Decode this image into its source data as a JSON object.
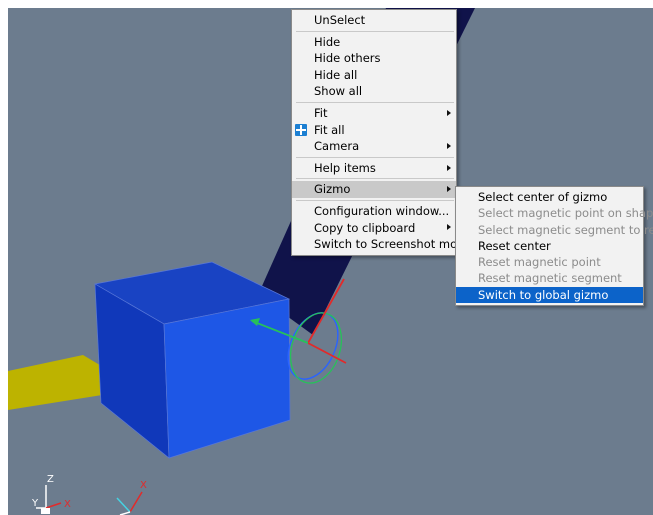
{
  "context_menu": {
    "items": [
      {
        "label": "UnSelect"
      },
      {
        "label": "Hide"
      },
      {
        "label": "Hide others"
      },
      {
        "label": "Hide all"
      },
      {
        "label": "Show all"
      },
      {
        "label": "Fit"
      },
      {
        "label": "Fit all",
        "icon": "fit-all-icon"
      },
      {
        "label": "Camera"
      },
      {
        "label": "Help items"
      },
      {
        "label": "Gizmo"
      },
      {
        "label": "Configuration window..."
      },
      {
        "label": "Copy to clipboard"
      },
      {
        "label": "Switch to Screenshot mode"
      }
    ]
  },
  "gizmo_submenu": {
    "items": [
      {
        "label": "Select center of gizmo",
        "enabled": true
      },
      {
        "label": "Select magnetic point on shape",
        "enabled": false
      },
      {
        "label": "Select magnetic segment to reach",
        "enabled": false
      },
      {
        "label": "Reset center",
        "enabled": true
      },
      {
        "label": "Reset magnetic point",
        "enabled": false
      },
      {
        "label": "Reset magnetic segment",
        "enabled": false
      },
      {
        "label": "Switch to global gizmo",
        "enabled": true
      }
    ]
  },
  "axis_labels": {
    "z": "Z",
    "y": "Y",
    "x": "X"
  },
  "colors": {
    "viewport_bg": "#6c7c8e",
    "menu_bg": "#f2f2f2",
    "highlight_blue": "#0c63c9",
    "cube_front": "#1e57e6",
    "yellow_plane": "#bdb300",
    "dark_band": "#10134a"
  }
}
